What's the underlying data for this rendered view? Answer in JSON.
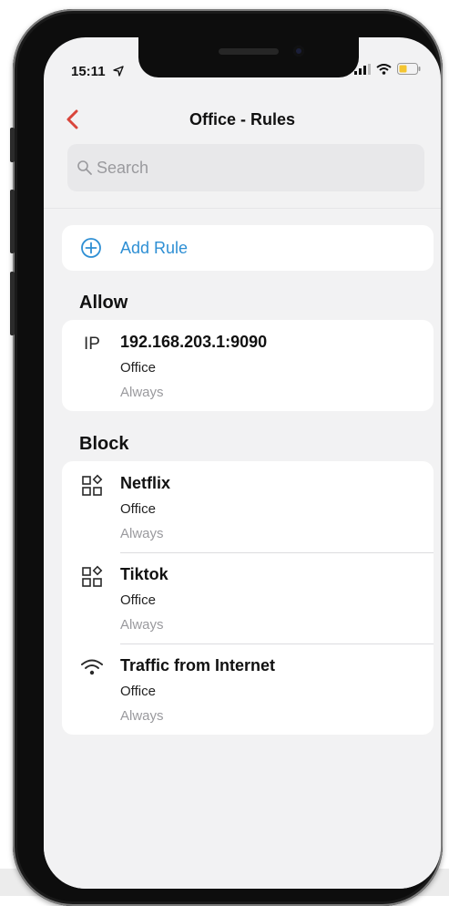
{
  "status_bar": {
    "time": "15:11"
  },
  "nav": {
    "title": "Office - Rules"
  },
  "search": {
    "placeholder": "Search"
  },
  "add_rule": {
    "label": "Add Rule"
  },
  "allow": {
    "title": "Allow",
    "rules": [
      {
        "icon": "ip-text-icon",
        "icon_text": "IP",
        "name": "192.168.203.1:9090",
        "group": "Office",
        "schedule": "Always"
      }
    ]
  },
  "block": {
    "title": "Block",
    "rules": [
      {
        "icon": "apps-icon",
        "name": "Netflix",
        "group": "Office",
        "schedule": "Always"
      },
      {
        "icon": "apps-icon",
        "name": "Tiktok",
        "group": "Office",
        "schedule": "Always"
      },
      {
        "icon": "wifi-icon",
        "name": "Traffic from Internet",
        "group": "Office",
        "schedule": "Always"
      }
    ]
  },
  "colors": {
    "accent_blue": "#2e8fd4",
    "back_red": "#d9453b",
    "background": "#f2f2f3",
    "card": "#ffffff"
  }
}
